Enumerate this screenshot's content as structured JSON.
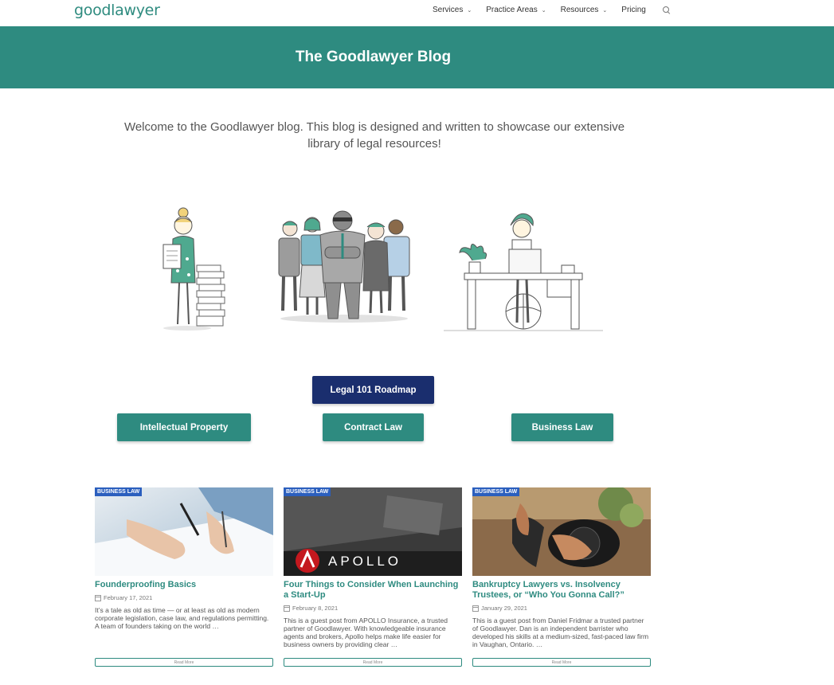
{
  "header": {
    "logo": "goodlawyer",
    "nav": [
      {
        "label": "Services",
        "dropdown": true
      },
      {
        "label": "Practice Areas",
        "dropdown": true
      },
      {
        "label": "Resources",
        "dropdown": true
      },
      {
        "label": "Pricing",
        "dropdown": false
      }
    ],
    "search_icon": "search-icon"
  },
  "banner": {
    "title": "The Goodlawyer Blog"
  },
  "intro": "Welcome to the Goodlawyer blog. This blog is designed and written to showcase our extensive library of legal resources!",
  "buttons": {
    "roadmap": "Legal 101 Roadmap",
    "ip": "Intellectual Property",
    "contract": "Contract Law",
    "business": "Business Law"
  },
  "cards": [
    {
      "badge": "BUSINESS LAW",
      "title": "Founderproofing Basics",
      "date": "February 17, 2021",
      "excerpt": "It’s a tale as old as time — or at least as old as modern corporate legislation, case law, and regulations permitting. A team of founders taking on the world …",
      "read_more": "Read More"
    },
    {
      "badge": "BUSINESS LAW",
      "title": "Four Things to Consider When Launching a Start-Up",
      "date": "February 8, 2021",
      "excerpt": "This is a guest post from APOLLO Insurance, a trusted partner of Goodlawyer. With knowledgeable insurance agents and brokers, Apollo helps make life easier for business owners by providing clear …",
      "read_more": "Read More",
      "image_text": "APOLLO"
    },
    {
      "badge": "BUSINESS LAW",
      "title": "Bankruptcy Lawyers vs. Insolvency Trustees, or “Who You Gonna Call?”",
      "date": "January 29, 2021",
      "excerpt": "This is a guest post from Daniel Fridmar a trusted partner of Goodlawyer.  Dan is an independent barrister who developed his skills at a medium-sized, fast-paced law firm in Vaughan, Ontario. …",
      "read_more": "Read More"
    }
  ],
  "colors": {
    "teal": "#2e8b80",
    "navy": "#1a2e6e",
    "badge": "#2b5fbe"
  }
}
